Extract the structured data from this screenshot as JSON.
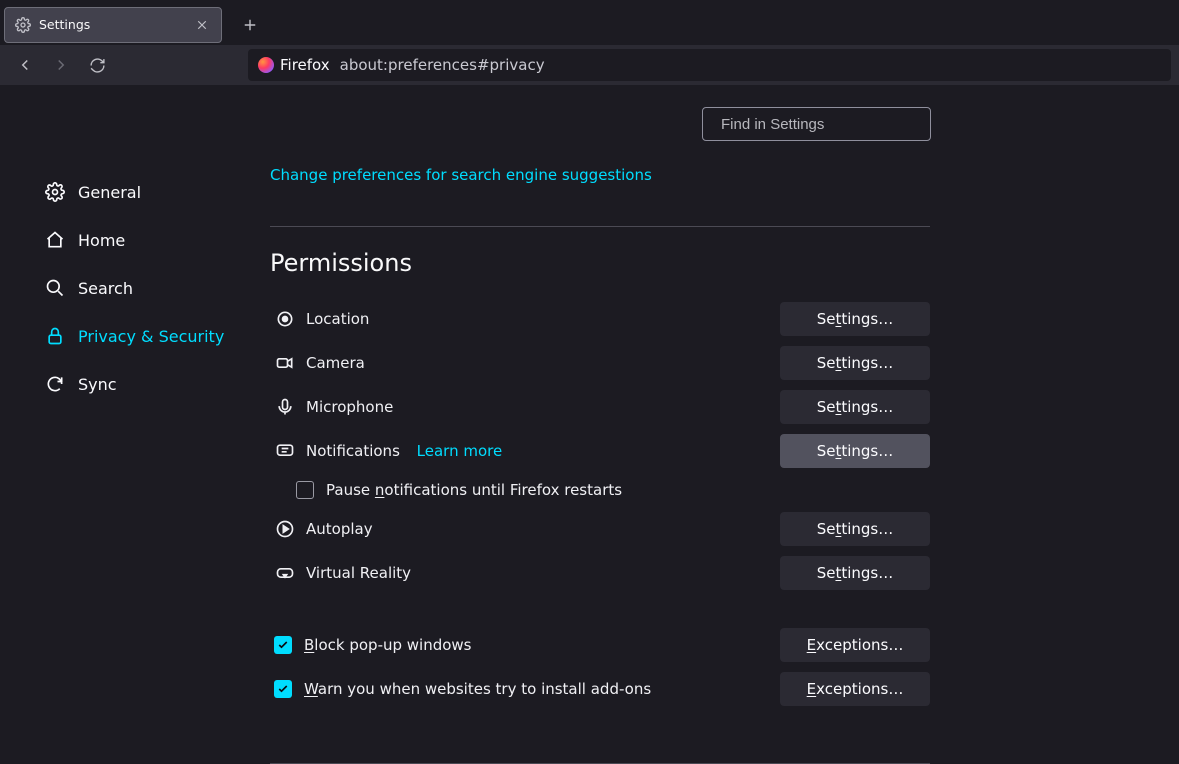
{
  "tab": {
    "title": "Settings"
  },
  "urlbar": {
    "identity": "Firefox",
    "path": "about:preferences#privacy"
  },
  "search": {
    "placeholder": "Find in Settings"
  },
  "sidebar": {
    "general": "General",
    "home": "Home",
    "search": "Search",
    "privacy": "Privacy & Security",
    "sync": "Sync"
  },
  "main": {
    "search_suggest_link": "Change preferences for search engine suggestions",
    "permissions_heading": "Permissions",
    "perm_location": "Location",
    "perm_camera": "Camera",
    "perm_microphone": "Microphone",
    "perm_notifications": "Notifications",
    "learn_more": "Learn more",
    "pause_notifications_prefix": "Pause ",
    "pause_notifications_mid": "n",
    "pause_notifications_suffix": "otifications until Firefox restarts",
    "perm_autoplay": "Autoplay",
    "perm_vr": "Virtual Reality",
    "block_popups_pre": "B",
    "block_popups_post": "lock pop-up windows",
    "warn_addons_pre": "W",
    "warn_addons_post": "arn you when websites try to install add-ons",
    "settings_btn_pre": "Se",
    "settings_btn_mid": "t",
    "settings_btn_post": "tings…",
    "exceptions_btn_pre": "E",
    "exceptions_btn_post": "xceptions…"
  },
  "checkboxes": {
    "pause_notifications": false,
    "block_popups": true,
    "warn_addons": true
  }
}
